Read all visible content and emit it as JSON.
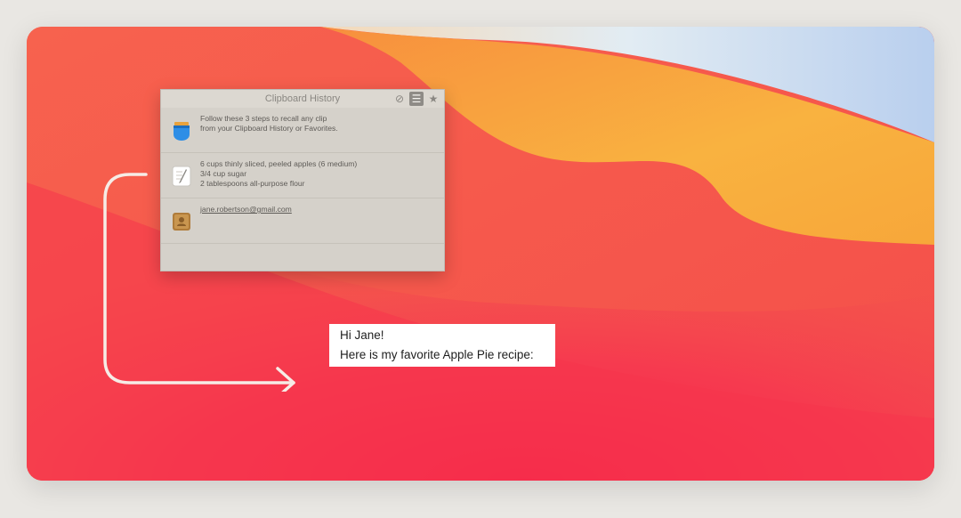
{
  "window": {
    "title": "Clipboard History",
    "toolbar_icons": [
      "clear-icon",
      "list-icon",
      "star-icon"
    ]
  },
  "clips": [
    {
      "icon": "pocket-app-icon",
      "lines": [
        "Follow these 3 steps to recall any clip",
        "from your Clipboard History or Favorites."
      ]
    },
    {
      "icon": "textedit-icon",
      "lines": [
        "6 cups thinly sliced, peeled apples (6 medium)",
        "3/4 cup sugar",
        "2 tablespoons all-purpose flour"
      ]
    },
    {
      "icon": "contacts-icon",
      "lines": [
        "jane.robertson@gmail.com"
      ]
    }
  ],
  "email": {
    "line1": "Hi Jane!",
    "line2": "Here is my favorite Apple Pie recipe:"
  },
  "colors": {
    "wallpaper_red": "#f5524a",
    "wallpaper_orange": "#f9a23c",
    "wallpaper_pink": "#f71f47",
    "window_bg": "#d5d1ca"
  }
}
